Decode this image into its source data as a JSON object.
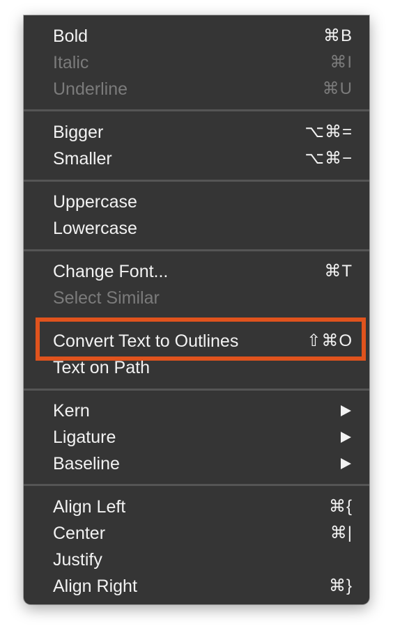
{
  "menu": {
    "groups": [
      [
        {
          "label": "Bold",
          "shortcut": "⌘B",
          "enabled": true
        },
        {
          "label": "Italic",
          "shortcut": "⌘I",
          "enabled": false
        },
        {
          "label": "Underline",
          "shortcut": "⌘U",
          "enabled": false
        }
      ],
      [
        {
          "label": "Bigger",
          "shortcut": "⌥⌘=",
          "enabled": true
        },
        {
          "label": "Smaller",
          "shortcut": "⌥⌘−",
          "enabled": true
        }
      ],
      [
        {
          "label": "Uppercase",
          "shortcut": "",
          "enabled": true
        },
        {
          "label": "Lowercase",
          "shortcut": "",
          "enabled": true
        }
      ],
      [
        {
          "label": "Change Font...",
          "shortcut": "⌘T",
          "enabled": true
        },
        {
          "label": "Select Similar",
          "shortcut": "",
          "enabled": false
        },
        {
          "label": "Convert Text to Outlines",
          "shortcut": "⇧⌘O",
          "enabled": true,
          "highlighted": true
        },
        {
          "label": "Text on Path",
          "shortcut": "",
          "enabled": true
        }
      ],
      [
        {
          "label": "Kern",
          "submenu": true,
          "enabled": true
        },
        {
          "label": "Ligature",
          "submenu": true,
          "enabled": true
        },
        {
          "label": "Baseline",
          "submenu": true,
          "enabled": true
        }
      ],
      [
        {
          "label": "Align Left",
          "shortcut": "⌘{",
          "enabled": true
        },
        {
          "label": "Center",
          "shortcut": "⌘|",
          "enabled": true
        },
        {
          "label": "Justify",
          "shortcut": "",
          "enabled": true
        },
        {
          "label": "Align Right",
          "shortcut": "⌘}",
          "enabled": true
        }
      ]
    ]
  },
  "colors": {
    "menu_background": "#353535",
    "text_enabled": "#f2f2f2",
    "text_disabled": "#7b7b7b",
    "separator": "#555555",
    "highlight_border": "#e0531d"
  }
}
